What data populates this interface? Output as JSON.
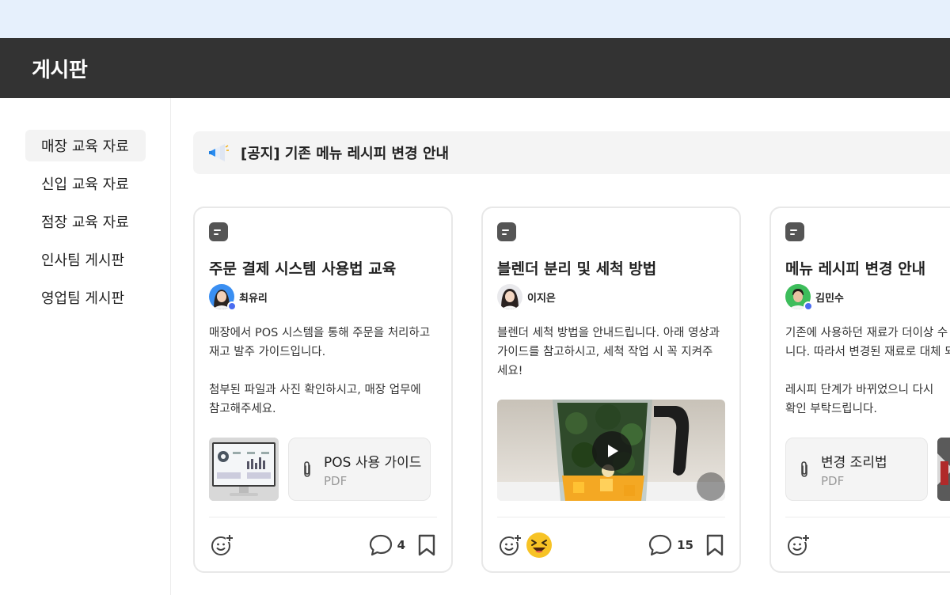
{
  "header": {
    "title": "게시판"
  },
  "sidebar": {
    "items": [
      {
        "label": "매장 교육 자료",
        "active": true
      },
      {
        "label": "신입 교육 자료",
        "active": false
      },
      {
        "label": "점장 교육 자료",
        "active": false
      },
      {
        "label": "인사팀 게시판",
        "active": false
      },
      {
        "label": "영업팀 게시판",
        "active": false
      }
    ]
  },
  "notice": {
    "icon": "megaphone-icon",
    "text": "[공지] 기존 메뉴 레시피 변경 안내"
  },
  "cards": [
    {
      "title": "주문 결제 시스템 사용법 교육",
      "author": "최유리",
      "body": [
        "매장에서 POS 시스템을 통해 주문을 처리하고",
        "재고 발주 가이드입니다.",
        "",
        "첨부된 파일과 사진 확인하시고, 매장 업무에",
        "참고해주세요."
      ],
      "attachment": {
        "name": "POS 사용 가이드",
        "type": "PDF"
      },
      "comments": "4"
    },
    {
      "title": "블렌더 분리 및 세척 방법",
      "author": "이지은",
      "body": [
        "블렌더 세척 방법을 안내드립니다. 아래 영상과",
        "가이드를 참고하시고, 세척 작업 시 꼭 지켜주",
        "세요!"
      ],
      "comments": "15"
    },
    {
      "title": "메뉴 레시피 변경 안내",
      "author": "김민수",
      "body": [
        "기존에 사용하던 재료가 더이상 수",
        "니다. 따라서 변경된 재료로 대체 되",
        "",
        "레시피 단계가 바뀌었으니 다시",
        "확인 부탁드립니다."
      ],
      "attachment": {
        "name": "변경 조리법",
        "type": "PDF"
      }
    }
  ],
  "colors": {
    "header_bg": "#333333",
    "top_band": "#e6f0fc",
    "accent_star": "#4a6cf0",
    "emoji_yellow": "#f7c325"
  }
}
